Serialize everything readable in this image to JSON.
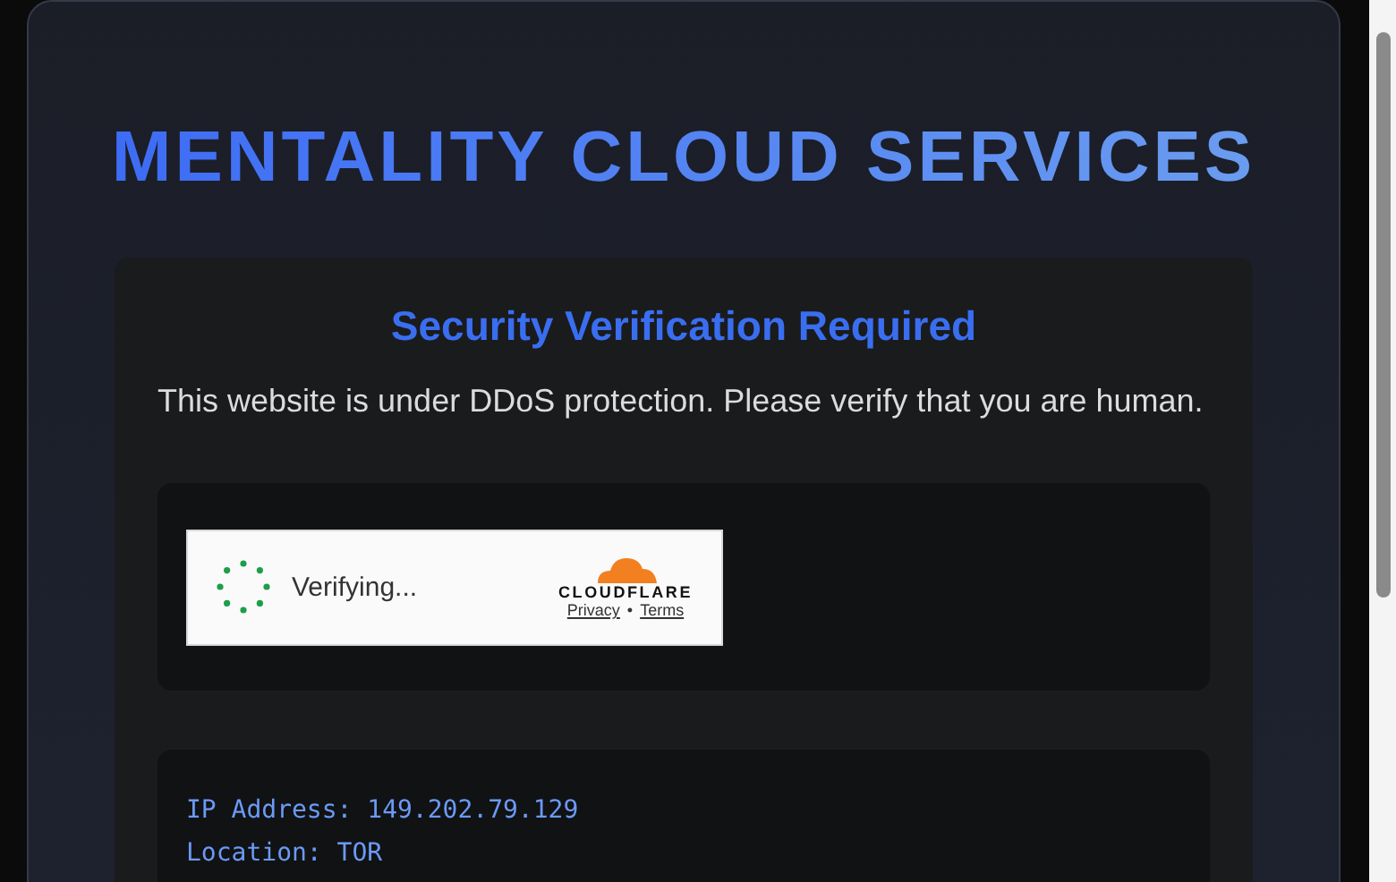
{
  "title": "MENTALITY CLOUD SERVICES",
  "card": {
    "heading": "Security Verification Required",
    "message": "This website is under DDoS protection. Please verify that you are human."
  },
  "widget": {
    "status": "Verifying...",
    "brand": "CLOUDFLARE",
    "links": [
      "Privacy",
      "Terms"
    ],
    "separator": "•"
  },
  "info": [
    "IP Address: 149.202.79.129",
    "Location: TOR"
  ]
}
